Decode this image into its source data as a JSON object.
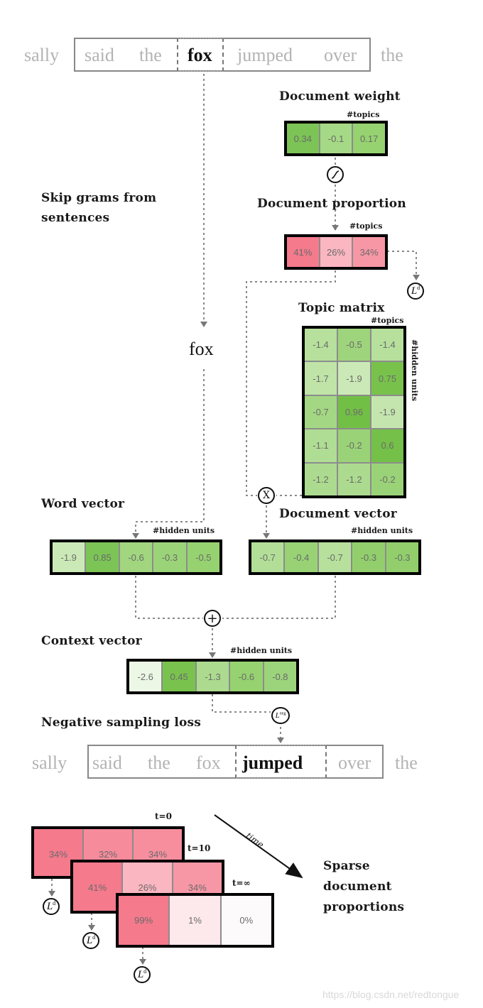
{
  "top_sentence": {
    "words": [
      "sally",
      "said",
      "the",
      "fox",
      "jumped",
      "over",
      "the"
    ],
    "focus_word": "fox"
  },
  "labels": {
    "skip_grams": [
      "Skip grams from",
      "sentences"
    ],
    "document_weight": "Document weight",
    "document_proportion": "Document proportion",
    "topic_matrix": "Topic matrix",
    "word_vector": "Word vector",
    "document_vector": "Document vector",
    "context_vector": "Context vector",
    "negative_sampling_loss": "Negative sampling loss",
    "sparse": [
      "Sparse",
      "document",
      "proportions"
    ],
    "topics_dim": "#topics",
    "hidden_dim": "#hidden units",
    "time": "time",
    "pivot_word": "fox"
  },
  "document_weight": {
    "values": [
      "0.34",
      "-0.1",
      "0.17"
    ],
    "colors": [
      "#7cc456",
      "#a6d986",
      "#96d270"
    ]
  },
  "document_proportion": {
    "values": [
      "41%",
      "26%",
      "34%"
    ],
    "colors": [
      "#f47a8c",
      "#fab6c1",
      "#f797a6"
    ]
  },
  "topic_matrix": {
    "rows": [
      [
        "-1.4",
        "-0.5",
        "-1.4"
      ],
      [
        "-1.7",
        "-1.9",
        "0.75"
      ],
      [
        "-0.7",
        "0.96",
        "-1.9"
      ],
      [
        "-1.1",
        "-0.2",
        "0.6"
      ],
      [
        "-1.2",
        "-1.2",
        "-0.2"
      ]
    ],
    "colors": [
      [
        "#b6e09c",
        "#9ed47c",
        "#b6e09c"
      ],
      [
        "#c0e4a8",
        "#cbe9b6",
        "#78c24c"
      ],
      [
        "#a4d784",
        "#72bf45",
        "#c4e6ae"
      ],
      [
        "#b0dd94",
        "#9ad377",
        "#74c048"
      ],
      [
        "#acdb8f",
        "#acdb8f",
        "#9ad377"
      ]
    ]
  },
  "word_vector": {
    "values": [
      "-1.9",
      "0.85",
      "-0.6",
      "-0.3",
      "-0.5"
    ],
    "colors": [
      "#cbe9b6",
      "#7cc456",
      "#a1d67f",
      "#9bd379",
      "#96d270"
    ]
  },
  "document_vector": {
    "values": [
      "-0.7",
      "-0.4",
      "-0.7",
      "-0.3",
      "-0.3"
    ],
    "colors": [
      "#b3de98",
      "#98d275",
      "#b6e09c",
      "#92cf6c",
      "#92cf6c"
    ]
  },
  "context_vector": {
    "values": [
      "-2.6",
      "0.45",
      "-1.3",
      "-0.6",
      "-0.8"
    ],
    "colors": [
      "#edf7e6",
      "#79c24e",
      "#acdb8f",
      "#96d270",
      "#9cd47b"
    ]
  },
  "operators": {
    "sigmoid": "~",
    "multiply": "X",
    "add": "+",
    "loss_doc": "L",
    "loss_doc_sup": "d",
    "loss_neg": "L",
    "loss_neg_sup": "neg"
  },
  "bottom_sentence": {
    "words": [
      "sally",
      "said",
      "the",
      "fox",
      "jumped",
      "over",
      "the"
    ],
    "focus_word": "jumped"
  },
  "timeline": [
    {
      "label": "t=0",
      "values": [
        "34%",
        "32%",
        "34%"
      ],
      "colors": [
        "#f47a8c",
        "#f68b9b",
        "#f68e9e"
      ]
    },
    {
      "label": "t=10",
      "values": [
        "41%",
        "26%",
        "34%"
      ],
      "colors": [
        "#f47a8c",
        "#fab6c1",
        "#f797a6"
      ]
    },
    {
      "label": "t=∞",
      "values": [
        "99%",
        "1%",
        "0%"
      ],
      "colors": [
        "#f47a8c",
        "#fde8ec",
        "#fdfafb"
      ]
    }
  ],
  "watermark": "https://blog.csdn.net/redtongue"
}
